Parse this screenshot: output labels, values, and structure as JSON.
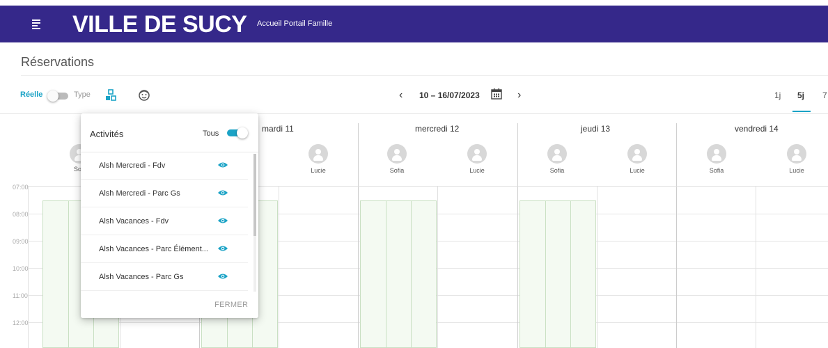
{
  "header": {
    "logo": "VILLE DE SUCY",
    "subtitle": "Accueil Portail Famille",
    "bg_color": "#35288a",
    "menu_icon": "menu-icon"
  },
  "page": {
    "title": "Réservations"
  },
  "toolbar": {
    "reelle_label": "Réelle",
    "type_label": "Type",
    "reelle_on": false,
    "activities_icon": "activities-icon",
    "children_icon": "face-icon",
    "date_range": "10 – 16/07/2023",
    "calendar_icon": "calendar-icon",
    "prev_icon": "‹",
    "next_icon": "›",
    "views": [
      "1j",
      "5j",
      "7"
    ],
    "active_view": "5j",
    "accent_color": "#1ba3c6"
  },
  "calendar": {
    "days": [
      {
        "label": "mardi 11",
        "people": [
          "Lucie"
        ]
      },
      {
        "label": "mercredi 12",
        "people": [
          "Sofia",
          "Lucie"
        ]
      },
      {
        "label": "jeudi 13",
        "people": [
          "Sofia",
          "Lucie"
        ]
      },
      {
        "label": "vendredi 14",
        "people": [
          "Sofia",
          "Lucie"
        ]
      }
    ],
    "first_day_visible_name": "So",
    "hours": [
      "07:00",
      "08:00",
      "09:00",
      "10:00",
      "11:00",
      "12:00"
    ]
  },
  "popup": {
    "title": "Activités",
    "tous_label": "Tous",
    "tous_on": true,
    "items": [
      {
        "label": "Alsh Mercredi - Fdv",
        "visible": true
      },
      {
        "label": "Alsh Mercredi - Parc Gs",
        "visible": true
      },
      {
        "label": "Alsh Vacances - Fdv",
        "visible": true
      },
      {
        "label": "Alsh Vacances - Parc Élément...",
        "visible": true
      },
      {
        "label": "Alsh Vacances - Parc Gs",
        "visible": true
      }
    ],
    "close_label": "FERMER"
  }
}
